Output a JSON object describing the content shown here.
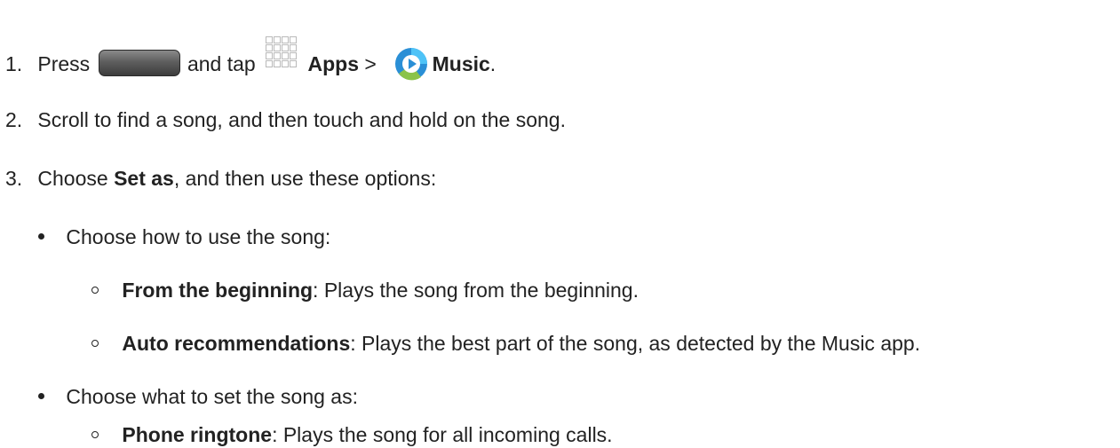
{
  "steps": [
    {
      "num": "1.",
      "press": "Press",
      "and_tap": "and tap",
      "apps": "Apps",
      "sep": " > ",
      "music": "Music",
      "end": "."
    },
    {
      "num": "2.",
      "text": "Scroll to find a song, and then touch and hold on the song."
    },
    {
      "num": "3.",
      "choose": "Choose ",
      "set_as": "Set as",
      "rest": ", and then use these options:"
    }
  ],
  "bullets": [
    {
      "text": "Choose how to use the song:",
      "options": [
        {
          "title": "From the beginning",
          "desc": ": Plays the song from the beginning."
        },
        {
          "title": "Auto recommendations",
          "desc": ": Plays the best part of the song, as detected by the Music app."
        }
      ]
    },
    {
      "text": "Choose what to set the song as:",
      "options": [
        {
          "title": "Phone ringtone",
          "desc": ": Plays the song for all incoming calls."
        }
      ]
    }
  ],
  "icons": {
    "key": "home-key-icon",
    "apps": "apps-grid-icon",
    "music": "music-app-icon"
  }
}
